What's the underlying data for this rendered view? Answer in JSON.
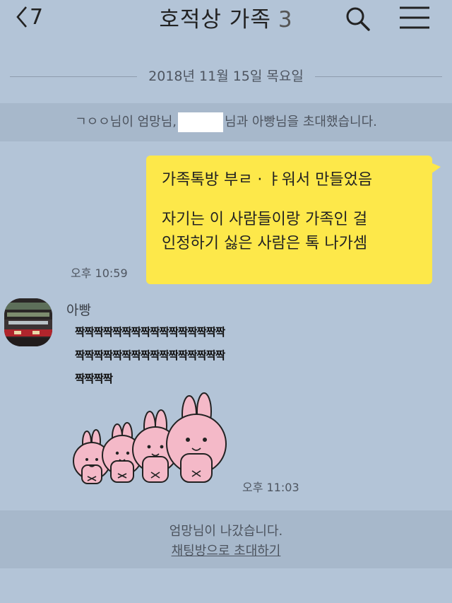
{
  "header": {
    "back_count": "7",
    "title": "호적상 가족",
    "member_count": "3"
  },
  "chat": {
    "date_divider": "2018년 11월 15일 목요일",
    "invite_notice": {
      "prefix": "ㄱㅇㅇ님이 엄망님,",
      "suffix": "님과 아빵님을 초대했습니다."
    },
    "my_message": {
      "line1": "가족톡방 부ㄹ · ㅑ워서 만들었음",
      "line2": "자기는 이 사람들이랑 가족인 걸",
      "line3": "인정하기 싫은 사람은 톡 나가셈",
      "time": "오후 10:59"
    },
    "dad_message": {
      "sender": "아빵",
      "sticker_text": "짝짝짝짝짝짝짝짝짝짝짝짝짝짝짝짝짝짝짝짝짝짝짝짝짝짝짝짝짝짝짝짝짝짝짝짝",
      "time": "오후 11:03"
    },
    "leave_notice": "엄망님이 나갔습니다.",
    "invite_link": "채팅방으로 초대하기"
  },
  "colors": {
    "background": "#b3c4d7",
    "notice_band": "#a7b8cb",
    "my_bubble": "#fde84a",
    "sticker_bunny": "#f4b9c8"
  },
  "icons": [
    "back-chevron-icon",
    "search-icon",
    "menu-icon",
    "bunny-sticker"
  ]
}
